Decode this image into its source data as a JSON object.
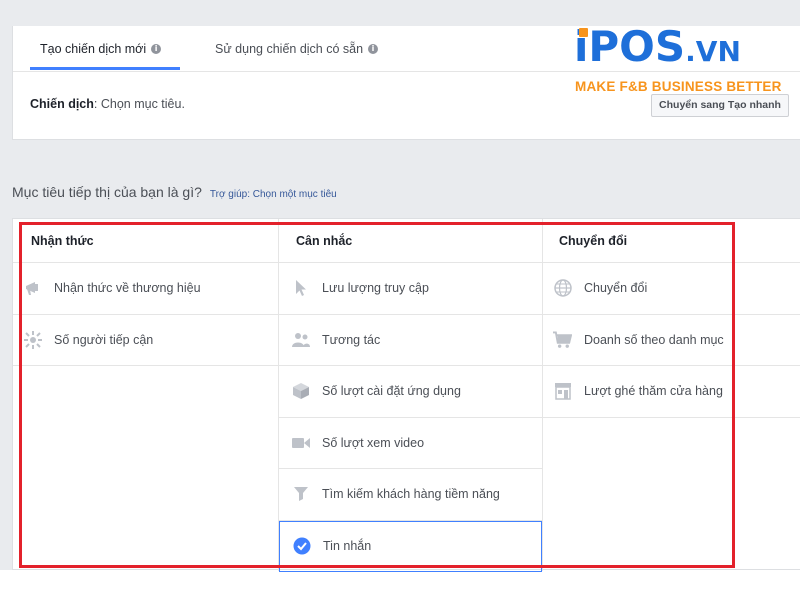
{
  "tabs": [
    {
      "label": "Tạo chiến dịch mới",
      "active": true
    },
    {
      "label": "Sử dụng chiến dịch có sẵn",
      "active": false
    }
  ],
  "campaign": {
    "label": "Chiến dịch",
    "value": ": Chọn mục tiêu."
  },
  "quick_create_button": "Chuyển sang Tạo nhanh",
  "logo": {
    "brand": "iPOS",
    "tld": ".VN",
    "tagline": "MAKE F&B BUSINESS BETTER",
    "colors": {
      "blue": "#1e6fd9",
      "orange": "#f7941d"
    }
  },
  "question": {
    "text": "Mục tiêu tiếp thị của bạn là gì?",
    "help_link": "Trợ giúp: Chọn một mục tiêu"
  },
  "columns": [
    {
      "heading": "Nhận thức",
      "items": [
        {
          "label": "Nhận thức về thương hiệu",
          "icon": "megaphone-icon"
        },
        {
          "label": "Số người tiếp cận",
          "icon": "reach-icon"
        }
      ]
    },
    {
      "heading": "Cân nhắc",
      "items": [
        {
          "label": "Lưu lượng truy cập",
          "icon": "cursor-icon"
        },
        {
          "label": "Tương tác",
          "icon": "people-icon"
        },
        {
          "label": "Số lượt cài đặt ứng dụng",
          "icon": "box-icon"
        },
        {
          "label": "Số lượt xem video",
          "icon": "video-camera-icon"
        },
        {
          "label": "Tìm kiếm khách hàng tiềm năng",
          "icon": "funnel-icon"
        },
        {
          "label": "Tin nhắn",
          "icon": "check-circle-icon",
          "selected": true
        }
      ]
    },
    {
      "heading": "Chuyển đổi",
      "items": [
        {
          "label": "Chuyển đổi",
          "icon": "globe-icon"
        },
        {
          "label": "Doanh số theo danh mục",
          "icon": "cart-icon"
        },
        {
          "label": "Lượt ghé thăm cửa hàng",
          "icon": "store-icon"
        }
      ]
    }
  ],
  "colors": {
    "accent": "#4080ff",
    "highlight_border": "#e3212b",
    "icon_gray": "#bec2c9"
  }
}
